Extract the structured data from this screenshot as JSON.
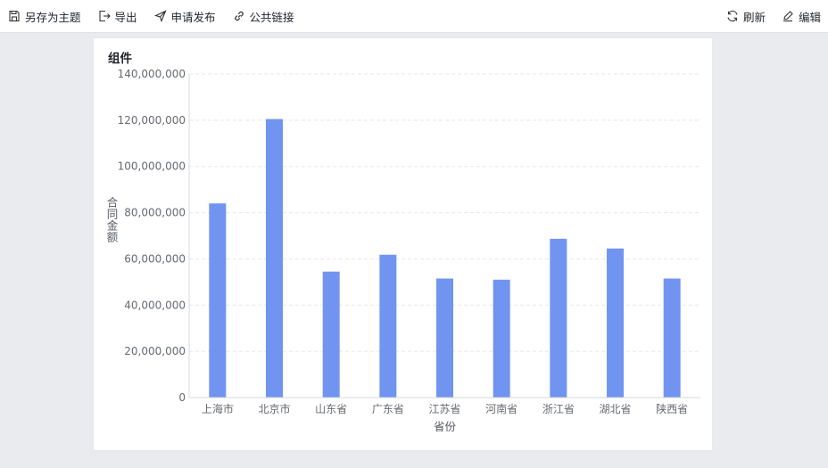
{
  "toolbar": {
    "save_as_theme": "另存为主题",
    "export": "导出",
    "apply_publish": "申请发布",
    "public_link": "公共链接",
    "refresh": "刷新",
    "edit": "编辑"
  },
  "card": {
    "title": "组件"
  },
  "colors": {
    "bar": "#7094f0",
    "grid": "#e6e8eb",
    "axis": "#d6d9dd"
  },
  "chart_data": {
    "type": "bar",
    "title": "",
    "xlabel": "省份",
    "ylabel": "合同金额",
    "categories": [
      "上海市",
      "北京市",
      "山东省",
      "广东省",
      "江苏省",
      "河南省",
      "浙江省",
      "湖北省",
      "陕西省"
    ],
    "values": [
      84000000,
      120500000,
      54500000,
      61800000,
      51500000,
      51000000,
      68700000,
      64500000,
      51500000
    ],
    "ylim": [
      0,
      140000000
    ],
    "yticks": [
      0,
      20000000,
      40000000,
      60000000,
      80000000,
      100000000,
      120000000,
      140000000
    ],
    "ytick_labels": [
      "0",
      "20,000,000",
      "40,000,000",
      "60,000,000",
      "80,000,000",
      "100,000,000",
      "120,000,000",
      "140,000,000"
    ],
    "grid": true
  }
}
